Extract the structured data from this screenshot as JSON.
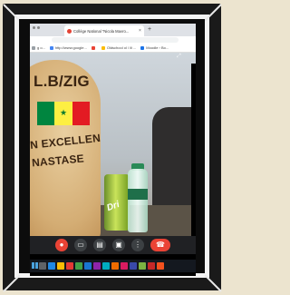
{
  "browser": {
    "tab_title": "Collège National \"Nicola Mavro...",
    "tab_close": "×",
    "new_tab": "+",
    "bookmarks": [
      {
        "label": "g o...",
        "color": "#9aa0a6"
      },
      {
        "label": "http://www.google...",
        "color": "#4285f4"
      },
      {
        "label": "",
        "color": "#ea4335"
      },
      {
        "label": "Oldschool ol / ili ...",
        "color": "#fbbc05"
      },
      {
        "label": "Moodle › Bo...",
        "color": "#1a73e8"
      }
    ]
  },
  "scene": {
    "plaque_line1": "L.B/ZIG",
    "plaque_line2": "N EXCELLENCE",
    "plaque_line3": "NASTASE",
    "can_label": "Dri",
    "flag_colors": [
      "#00853f",
      "#fdef42",
      "#e31b23"
    ],
    "flag_star": "★",
    "pip_icon": "⤢"
  },
  "controls": {
    "mic_off": "●",
    "camera": "▭",
    "captions": "▤",
    "present": "▣",
    "more": "⋮",
    "end_call": "☎",
    "accent_end_call": "#ea4335"
  },
  "taskbar": {
    "apps": [
      "#5f6368",
      "#1e88e5",
      "#fbbc05",
      "#e53935",
      "#43a047",
      "#1976d2",
      "#8e24aa",
      "#00acc1",
      "#ef6c00",
      "#d81b60",
      "#3949ab",
      "#7cb342",
      "#c62828",
      "#f4511e"
    ]
  }
}
